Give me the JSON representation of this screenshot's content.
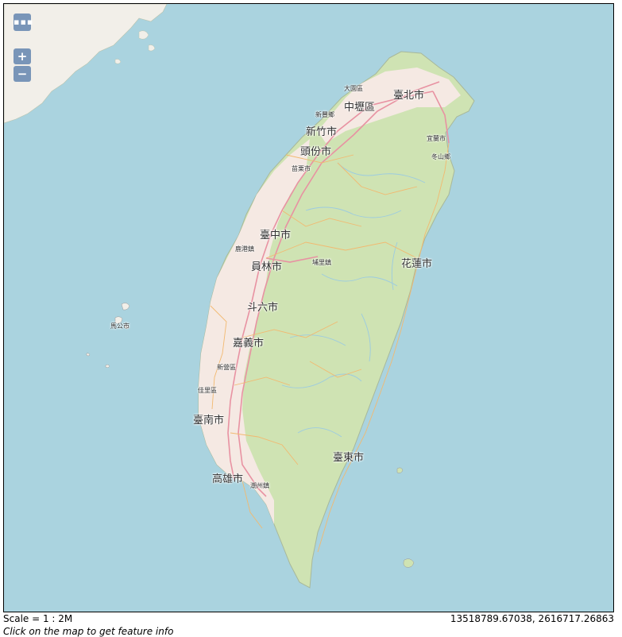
{
  "map": {
    "controls": {
      "layers_label": "▪▪▪",
      "zoom_in_label": "+",
      "zoom_out_label": "−"
    },
    "places": {
      "taipei": "臺北市",
      "zhongli": "中壢區",
      "dayuan": "大園區",
      "xinfeng": "新豐鄉",
      "hsinchu": "新竹市",
      "toufen": "頭份市",
      "miaoli": "苗栗市",
      "yilan": "宜蘭市",
      "dongshan": "冬山鄉",
      "taichung": "臺中市",
      "lugang": "鹿港鎮",
      "yuanlin": "員林市",
      "puli": "埔里鎮",
      "hualien": "花蓮市",
      "douliu": "斗六市",
      "magong": "馬公市",
      "chiayi": "嘉義市",
      "xinying": "新營區",
      "jiali": "佳里區",
      "tainan": "臺南市",
      "taitung": "臺東市",
      "kaohsiung": "高雄市",
      "chaozhou": "潮州鎮"
    },
    "colors": {
      "sea": "#aad3df",
      "land": "#cfe3b3",
      "mainland": "#f2efe9",
      "urban": "#f0e0dc",
      "road_major": "#e892a2",
      "road_minor": "#f7c98e",
      "river": "#aad3df"
    }
  },
  "footer": {
    "scale": "Scale = 1 : 2M",
    "coordinates": "13518789.67038, 2616717.26863",
    "hint": "Click on the map to get feature info"
  }
}
